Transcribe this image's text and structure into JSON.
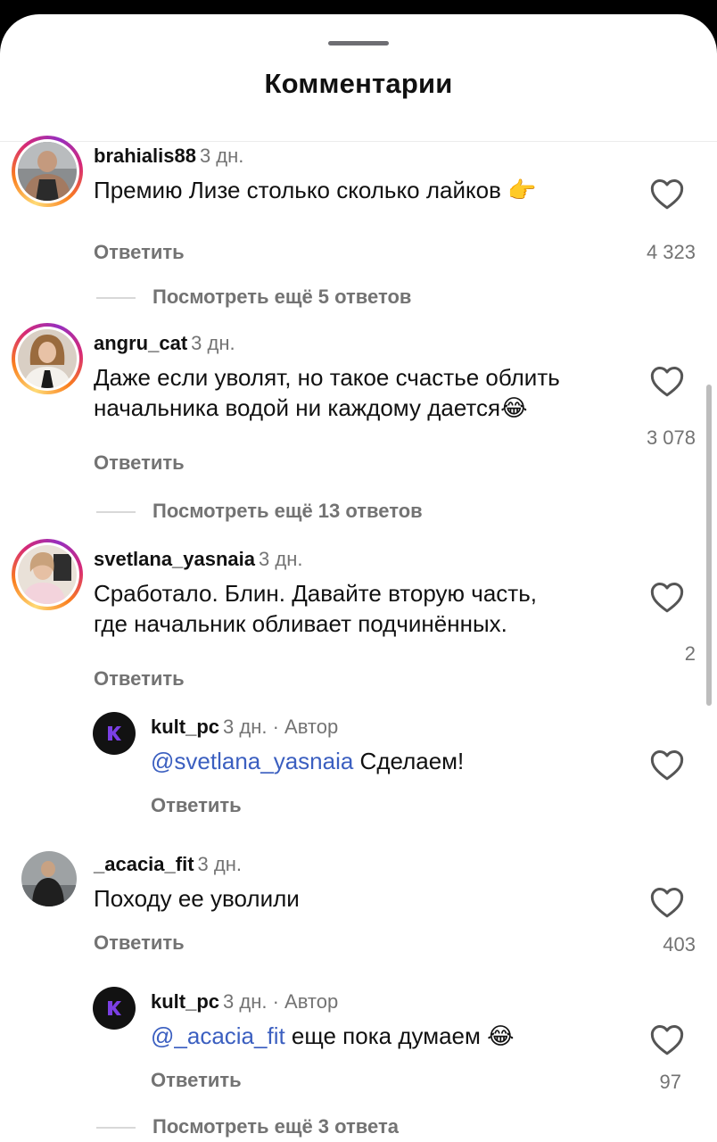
{
  "sheet": {
    "title": "Комментарии"
  },
  "comments": [
    {
      "username": "brahialis88",
      "time": "3 дн.",
      "text": "Премию Лизе столько сколько лайков 👉",
      "reply_label": "Ответить",
      "likes": "4 323",
      "more_replies": "Посмотреть ещё 5 ответов"
    },
    {
      "username": "angru_cat",
      "time": "3 дн.",
      "text_line1": "Даже если уволят, но такое счастье облить",
      "text_line2": "начальника водой ни каждому дается😂",
      "reply_label": "Ответить",
      "likes": "3 078",
      "more_replies": "Посмотреть ещё 13 ответов"
    },
    {
      "username": "svetlana_yasnaia",
      "time": "3 дн.",
      "text_line1": "Сработало. Блин. Давайте вторую часть,",
      "text_line2": "где начальник обливает подчинённых.",
      "reply_label": "Ответить",
      "likes": "2"
    },
    {
      "username": "kult_pc",
      "time": "3 дн. · Автор",
      "mention": "@svetlana_yasnaia",
      "text": " Сделаем!",
      "reply_label": "Ответить"
    },
    {
      "username": "_acacia_fit",
      "time": "3 дн.",
      "text": "Походу ее уволили",
      "reply_label": "Ответить",
      "likes": "403"
    },
    {
      "username": "kult_pc",
      "time": "3 дн. · Автор",
      "mention": "@_acacia_fit",
      "text": " еще пока думаем 😂",
      "reply_label": "Ответить",
      "likes": "97",
      "more_replies": "Посмотреть ещё 3 ответа"
    }
  ],
  "colors": {
    "mention": "#3b5fc0",
    "muted": "#737373",
    "author_avatar": "#121212",
    "author_logo": "#7b3fe4"
  },
  "icons": {
    "like": "heart-outline-icon",
    "author_logo": "k-logo-icon"
  }
}
